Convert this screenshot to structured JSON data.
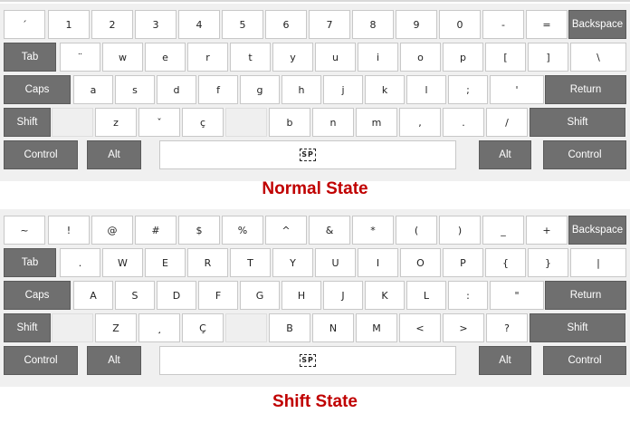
{
  "keyboards": [
    {
      "id": "normal",
      "label": "Normal State",
      "rows": [
        [
          {
            "label": "´"
          },
          {
            "label": "1"
          },
          {
            "label": "2"
          },
          {
            "label": "3"
          },
          {
            "label": "4"
          },
          {
            "label": "5"
          },
          {
            "label": "6"
          },
          {
            "label": "7"
          },
          {
            "label": "8"
          },
          {
            "label": "9"
          },
          {
            "label": "0"
          },
          {
            "label": "-"
          },
          {
            "label": "="
          },
          {
            "label": "Backspace",
            "mod": true
          }
        ],
        [
          {
            "label": "Tab",
            "mod": true
          },
          {
            "label": "¨"
          },
          {
            "label": "w"
          },
          {
            "label": "e"
          },
          {
            "label": "r"
          },
          {
            "label": "t"
          },
          {
            "label": "y"
          },
          {
            "label": "u"
          },
          {
            "label": "i"
          },
          {
            "label": "o"
          },
          {
            "label": "p"
          },
          {
            "label": "["
          },
          {
            "label": "]"
          },
          {
            "label": "\\"
          }
        ],
        [
          {
            "label": "Caps",
            "mod": true
          },
          {
            "label": "a"
          },
          {
            "label": "s"
          },
          {
            "label": "d"
          },
          {
            "label": "f"
          },
          {
            "label": "g"
          },
          {
            "label": "h"
          },
          {
            "label": "j"
          },
          {
            "label": "k"
          },
          {
            "label": "l"
          },
          {
            "label": ";"
          },
          {
            "label": "'"
          },
          {
            "label": "Return",
            "mod": true
          }
        ],
        [
          {
            "label": "Shift",
            "mod": true
          },
          {
            "label": ""
          },
          {
            "label": "z"
          },
          {
            "label": "ˇ"
          },
          {
            "label": "ç"
          },
          {
            "label": ""
          },
          {
            "label": "b"
          },
          {
            "label": "n"
          },
          {
            "label": "m"
          },
          {
            "label": ","
          },
          {
            "label": "."
          },
          {
            "label": "/"
          },
          {
            "label": "Shift",
            "mod": true
          }
        ],
        [
          {
            "label": "Control",
            "mod": true
          },
          {
            "label": "Alt",
            "mod": true
          },
          {
            "label": "SP"
          },
          {
            "label": "Alt",
            "mod": true
          },
          {
            "label": "Control",
            "mod": true
          }
        ]
      ]
    },
    {
      "id": "shift",
      "label": "Shift State",
      "rows": [
        [
          {
            "label": "~"
          },
          {
            "label": "!"
          },
          {
            "label": "@"
          },
          {
            "label": "#"
          },
          {
            "label": "$"
          },
          {
            "label": "%"
          },
          {
            "label": "^"
          },
          {
            "label": "&"
          },
          {
            "label": "*"
          },
          {
            "label": "("
          },
          {
            "label": ")"
          },
          {
            "label": "_"
          },
          {
            "label": "+"
          },
          {
            "label": "Backspace",
            "mod": true
          }
        ],
        [
          {
            "label": "Tab",
            "mod": true
          },
          {
            "label": "."
          },
          {
            "label": "W"
          },
          {
            "label": "E"
          },
          {
            "label": "R"
          },
          {
            "label": "T"
          },
          {
            "label": "Y"
          },
          {
            "label": "U"
          },
          {
            "label": "I"
          },
          {
            "label": "O"
          },
          {
            "label": "P"
          },
          {
            "label": "{"
          },
          {
            "label": "}"
          },
          {
            "label": "|"
          }
        ],
        [
          {
            "label": "Caps",
            "mod": true
          },
          {
            "label": "A"
          },
          {
            "label": "S"
          },
          {
            "label": "D"
          },
          {
            "label": "F"
          },
          {
            "label": "G"
          },
          {
            "label": "H"
          },
          {
            "label": "J"
          },
          {
            "label": "K"
          },
          {
            "label": "L"
          },
          {
            "label": ":"
          },
          {
            "label": "\""
          },
          {
            "label": "Return",
            "mod": true
          }
        ],
        [
          {
            "label": "Shift",
            "mod": true
          },
          {
            "label": ""
          },
          {
            "label": "Z"
          },
          {
            "label": "¸"
          },
          {
            "label": "Ç"
          },
          {
            "label": ""
          },
          {
            "label": "B"
          },
          {
            "label": "N"
          },
          {
            "label": "M"
          },
          {
            "label": "<"
          },
          {
            "label": ">"
          },
          {
            "label": "?"
          },
          {
            "label": "Shift",
            "mod": true
          }
        ],
        [
          {
            "label": "Control",
            "mod": true
          },
          {
            "label": "Alt",
            "mod": true
          },
          {
            "label": "SP"
          },
          {
            "label": "Alt",
            "mod": true
          },
          {
            "label": "Control",
            "mod": true
          }
        ]
      ]
    }
  ]
}
